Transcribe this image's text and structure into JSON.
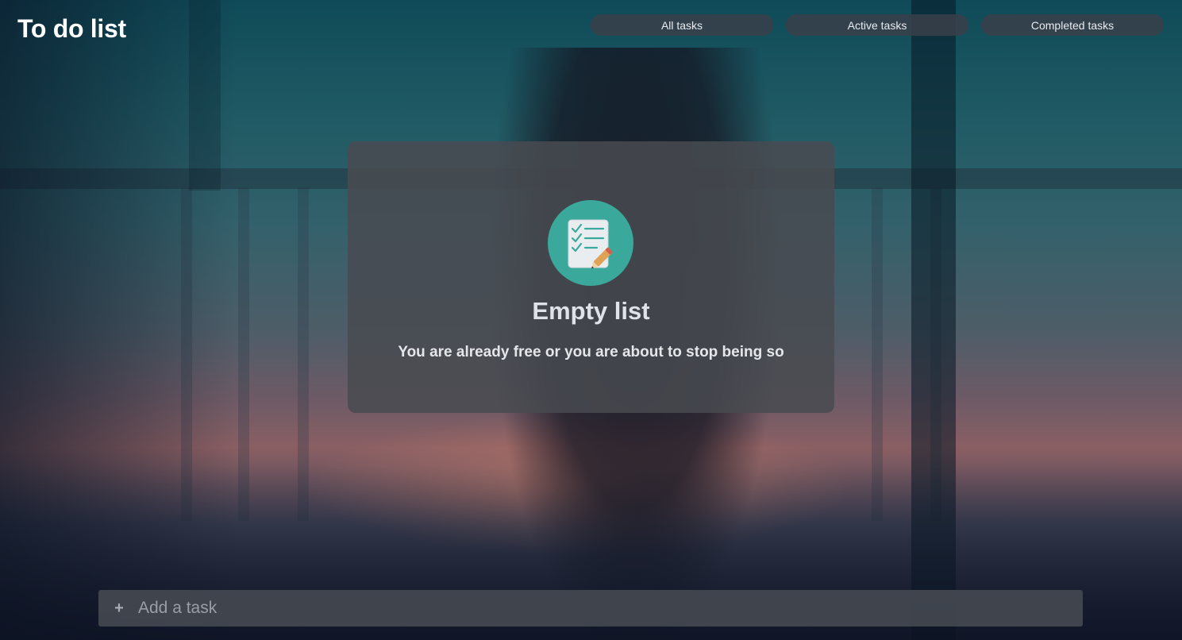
{
  "app": {
    "title": "To do list"
  },
  "filters": {
    "all_label": "All tasks",
    "active_label": "Active tasks",
    "completed_label": "Completed tasks"
  },
  "empty_state": {
    "icon": "checklist-icon",
    "title": "Empty list",
    "subtitle": "You are already free or you are about to stop being so"
  },
  "add_task": {
    "icon": "plus-icon",
    "symbol": "+",
    "placeholder": "Add a task",
    "value": ""
  },
  "colors": {
    "accent": "#3aa89a",
    "text": "#ffffff"
  }
}
